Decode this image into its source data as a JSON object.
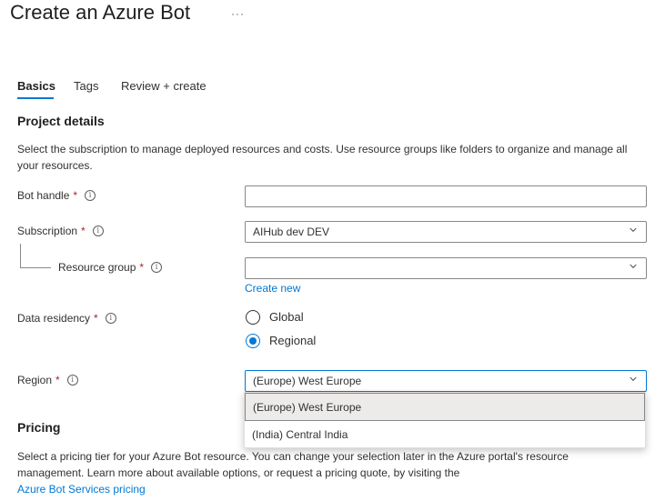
{
  "page": {
    "title": "Create an Azure Bot",
    "more": "···"
  },
  "tabs": [
    {
      "label": "Basics",
      "active": true
    },
    {
      "label": "Tags",
      "active": false
    },
    {
      "label": "Review + create",
      "active": false
    }
  ],
  "project_details": {
    "heading": "Project details",
    "description": "Select the subscription to manage deployed resources and costs. Use resource groups like folders to organize and manage all your resources."
  },
  "form": {
    "required_marker": "*",
    "info_glyph": "i",
    "bot_handle": {
      "label": "Bot handle",
      "value": ""
    },
    "subscription": {
      "label": "Subscription",
      "value": "AIHub dev DEV"
    },
    "resource_group": {
      "label": "Resource group",
      "value": "",
      "create_new": "Create new"
    },
    "data_residency": {
      "label": "Data residency",
      "options": [
        {
          "label": "Global",
          "checked": false
        },
        {
          "label": "Regional",
          "checked": true
        }
      ]
    },
    "region": {
      "label": "Region",
      "value": "(Europe) West Europe",
      "options": [
        "(Europe) West Europe",
        "(India) Central India"
      ],
      "selected": "(Europe) West Europe"
    }
  },
  "pricing": {
    "heading": "Pricing",
    "description": "Select a pricing tier for your Azure Bot resource. You can change your selection later in the Azure portal's resource management. Learn more about available options, or request a pricing quote, by visiting the",
    "link": "Azure Bot Services pricing"
  },
  "colors": {
    "accent": "#0078d4",
    "required": "#a4262c"
  }
}
